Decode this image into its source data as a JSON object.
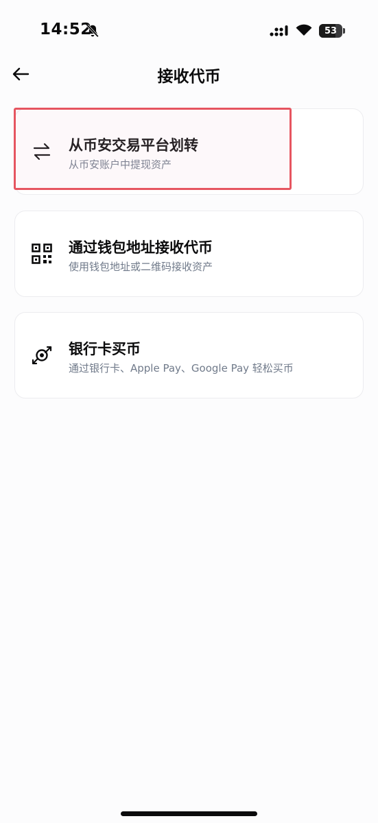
{
  "status_bar": {
    "time": "14:52",
    "battery": "53",
    "icons": [
      "bell-slash-icon",
      "signal-icon",
      "wifi-icon",
      "battery-icon"
    ]
  },
  "header": {
    "title": "接收代币",
    "back_icon": "arrow-left-icon"
  },
  "options": [
    {
      "icon": "swap-arrows-icon",
      "title": "从币安交易平台划转",
      "subtitle": "从币安账户中提现资产"
    },
    {
      "icon": "qr-code-icon",
      "title": "通过钱包地址接收代币",
      "subtitle": "使用钱包地址或二维码接收资产"
    },
    {
      "icon": "buy-crypto-icon",
      "title": "银行卡买币",
      "subtitle": "通过银行卡、Apple Pay、Google Pay 轻松买币"
    }
  ],
  "highlight_color": "#e65560"
}
